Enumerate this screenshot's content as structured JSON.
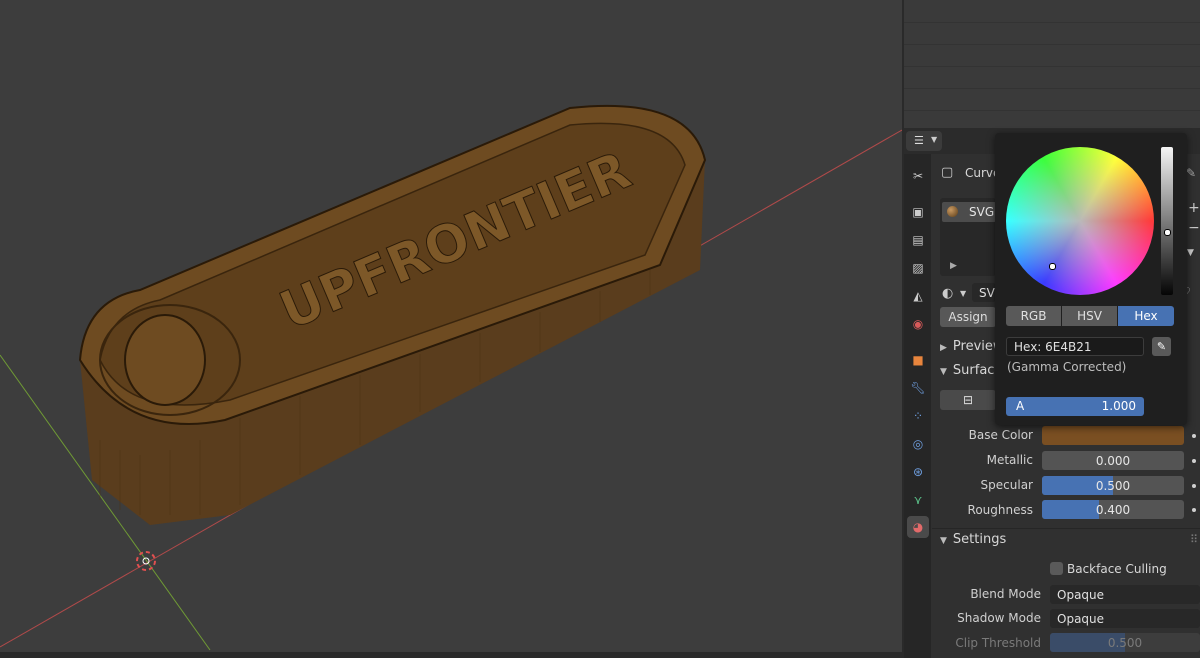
{
  "viewport": {
    "object_text": "UPFRONTIER"
  },
  "properties": {
    "object_name": "Curve",
    "material_slot": "SVGM",
    "material_name": "SVGM",
    "assign_label": "Assign",
    "preview_label": "Preview",
    "surface_label": "Surface",
    "settings_label": "Settings",
    "base_color_label": "Base Color",
    "base_color_hex": "#7a4f22",
    "metallic_label": "Metallic",
    "metallic_value": "0.000",
    "specular_label": "Specular",
    "specular_value": "0.500",
    "specular_fraction": 0.5,
    "roughness_label": "Roughness",
    "roughness_value": "0.400",
    "roughness_fraction": 0.4,
    "backface_label": "Backface Culling",
    "blend_mode_label": "Blend Mode",
    "blend_mode_value": "Opaque",
    "shadow_mode_label": "Shadow Mode",
    "shadow_mode_value": "Opaque",
    "clip_threshold_label": "Clip Threshold",
    "clip_threshold_value": "0.500"
  },
  "color_picker": {
    "modes": [
      "RGB",
      "HSV",
      "Hex"
    ],
    "active_mode": "Hex",
    "hex_text": "Hex: 6E4B21",
    "gamma_note": "(Gamma Corrected)",
    "alpha_label": "A",
    "alpha_value": "1.000"
  },
  "colors": {
    "accent": "#4772b3",
    "object_brown": "#6e4b21"
  }
}
